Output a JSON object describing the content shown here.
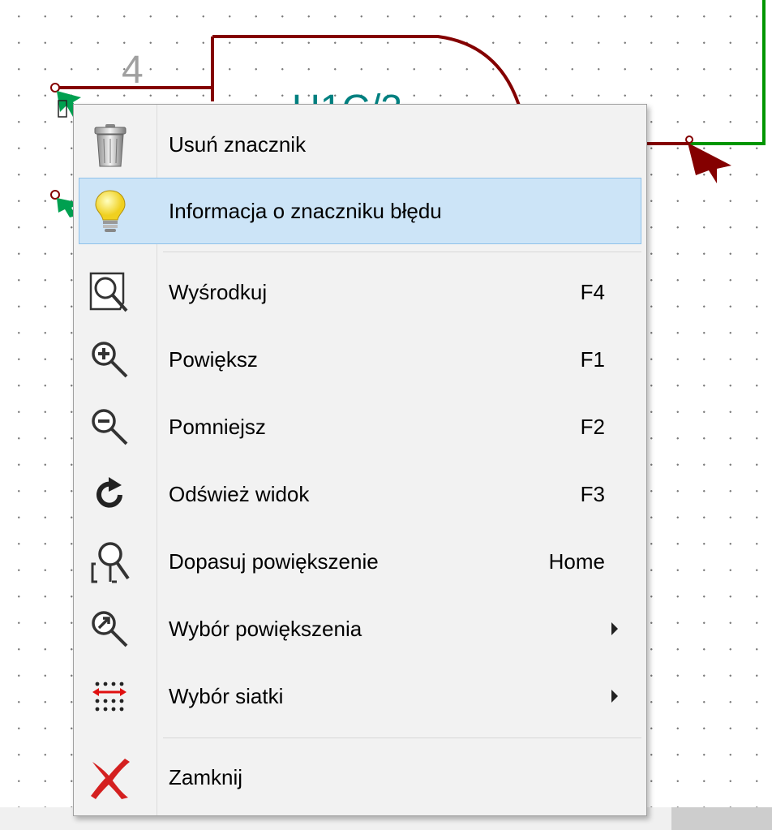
{
  "schematic": {
    "pin_number": "4"
  },
  "context_menu": {
    "items": [
      {
        "id": "delete-marker",
        "label": "Usuń znacznik",
        "shortcut": "",
        "icon": "trash-icon",
        "highlighted": false
      },
      {
        "id": "marker-info",
        "label": "Informacja o znaczniku błędu",
        "shortcut": "",
        "icon": "lightbulb-icon",
        "highlighted": true
      },
      {
        "id": "center",
        "label": "Wyśrodkuj",
        "shortcut": "F4",
        "icon": "zoom-center-icon"
      },
      {
        "id": "zoom-in",
        "label": "Powiększ",
        "shortcut": "F1",
        "icon": "zoom-in-icon"
      },
      {
        "id": "zoom-out",
        "label": "Pomniejsz",
        "shortcut": "F2",
        "icon": "zoom-out-icon"
      },
      {
        "id": "refresh",
        "label": "Odśwież widok",
        "shortcut": "F3",
        "icon": "refresh-icon"
      },
      {
        "id": "zoom-fit",
        "label": "Dopasuj powiększenie",
        "shortcut": "Home",
        "icon": "zoom-fit-icon"
      },
      {
        "id": "zoom-select",
        "label": "Wybór powiększenia",
        "shortcut": "",
        "icon": "zoom-select-icon",
        "submenu": true
      },
      {
        "id": "grid-select",
        "label": "Wybór siatki",
        "shortcut": "",
        "icon": "grid-icon",
        "submenu": true
      },
      {
        "id": "close",
        "label": "Zamknij",
        "shortcut": "",
        "icon": "close-icon"
      }
    ]
  },
  "colors": {
    "wire_dark_red": "#840000",
    "wire_green": "#009600",
    "marker_green": "#00a050",
    "highlight_bg": "#cce4f7",
    "highlight_border": "#8fc1ea"
  }
}
